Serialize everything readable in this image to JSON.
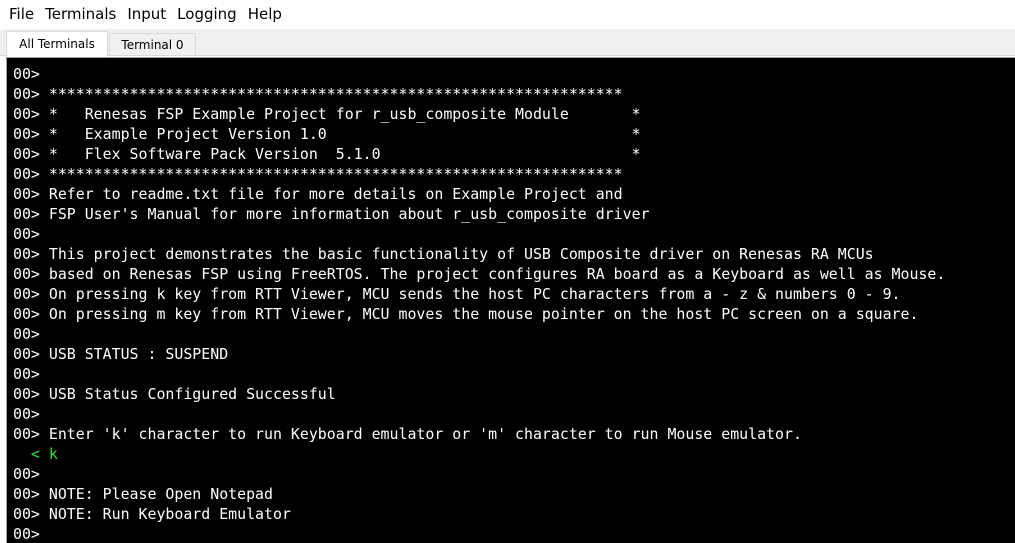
{
  "menubar": {
    "items": [
      "File",
      "Terminals",
      "Input",
      "Logging",
      "Help"
    ]
  },
  "tabs": {
    "all_terminals": "All Terminals",
    "terminal_0": "Terminal 0"
  },
  "colors": {
    "terminal_background": "#000000",
    "output_text": "#ffffff",
    "input_text": "#33dd33"
  },
  "terminal": {
    "lines": [
      {
        "text": "00>",
        "kind": "output"
      },
      {
        "text": "00> ****************************************************************",
        "kind": "output"
      },
      {
        "text": "00> *   Renesas FSP Example Project for r_usb_composite Module       *",
        "kind": "output"
      },
      {
        "text": "00> *   Example Project Version 1.0                                  *",
        "kind": "output"
      },
      {
        "text": "00> *   Flex Software Pack Version  5.1.0                            *",
        "kind": "output"
      },
      {
        "text": "00> ****************************************************************",
        "kind": "output"
      },
      {
        "text": "00> Refer to readme.txt file for more details on Example Project and",
        "kind": "output"
      },
      {
        "text": "00> FSP User's Manual for more information about r_usb_composite driver",
        "kind": "output"
      },
      {
        "text": "00>",
        "kind": "output"
      },
      {
        "text": "00> This project demonstrates the basic functionality of USB Composite driver on Renesas RA MCUs",
        "kind": "output"
      },
      {
        "text": "00> based on Renesas FSP using FreeRTOS. The project configures RA board as a Keyboard as well as Mouse.",
        "kind": "output"
      },
      {
        "text": "00> On pressing k key from RTT Viewer, MCU sends the host PC characters from a - z & numbers 0 - 9.",
        "kind": "output"
      },
      {
        "text": "00> On pressing m key from RTT Viewer, MCU moves the mouse pointer on the host PC screen on a square.",
        "kind": "output"
      },
      {
        "text": "00>",
        "kind": "output"
      },
      {
        "text": "00> USB STATUS : SUSPEND",
        "kind": "output"
      },
      {
        "text": "00>",
        "kind": "output"
      },
      {
        "text": "00> USB Status Configured Successful",
        "kind": "output"
      },
      {
        "text": "00>",
        "kind": "output"
      },
      {
        "text": "00> Enter 'k' character to run Keyboard emulator or 'm' character to run Mouse emulator.",
        "kind": "output"
      },
      {
        "text": "  < k",
        "kind": "input"
      },
      {
        "text": "00>",
        "kind": "output"
      },
      {
        "text": "00> NOTE: Please Open Notepad",
        "kind": "output"
      },
      {
        "text": "00> NOTE: Run Keyboard Emulator",
        "kind": "output"
      },
      {
        "text": "00>",
        "kind": "output"
      }
    ]
  }
}
